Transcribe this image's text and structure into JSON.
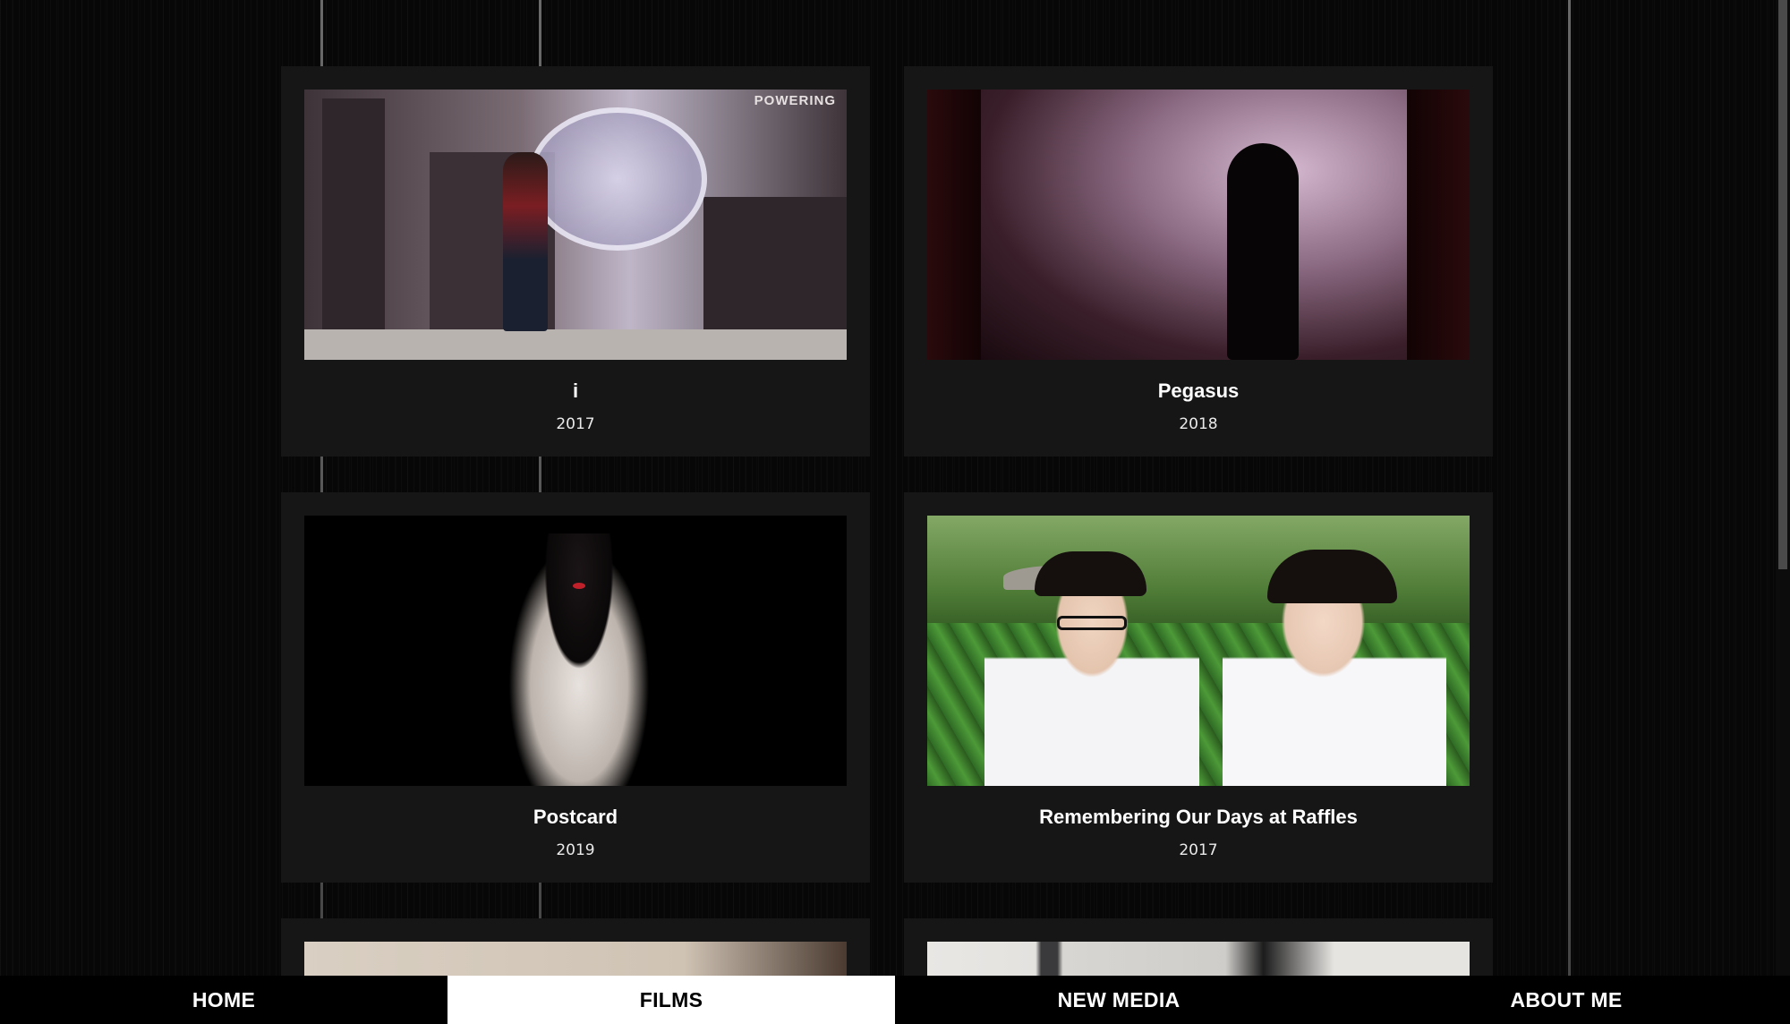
{
  "films": [
    {
      "title": "i",
      "year": "2017"
    },
    {
      "title": "Pegasus",
      "year": "2018"
    },
    {
      "title": "Postcard",
      "year": "2019"
    },
    {
      "title": "Remembering Our Days at Raffles",
      "year": "2017"
    }
  ],
  "thumbnails": {
    "mural_sign": "POWERING"
  },
  "nav": {
    "items": [
      {
        "label": "HOME",
        "active": false
      },
      {
        "label": "FILMS",
        "active": true
      },
      {
        "label": "NEW MEDIA",
        "active": false
      },
      {
        "label": "ABOUT ME",
        "active": false
      }
    ]
  },
  "colors": {
    "background": "#070707",
    "card": "#161616",
    "nav_active_bg": "#ffffff",
    "nav_active_text": "#000000",
    "nav_bg": "#000000"
  },
  "icons": []
}
